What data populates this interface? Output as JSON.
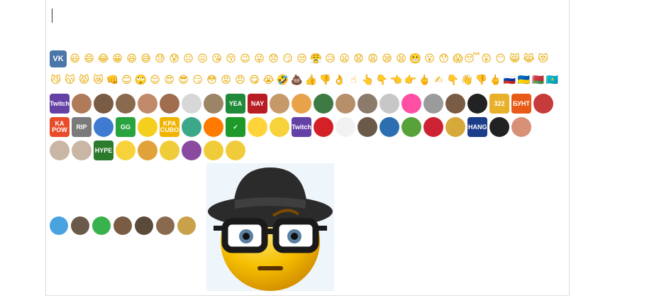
{
  "editor": {
    "cursor": "|"
  },
  "row1": {
    "vk_label": "VK",
    "emoji": [
      "😃",
      "😄",
      "😂",
      "😁",
      "😆",
      "😅",
      "😓",
      "😰",
      "😐",
      "😖",
      "😘",
      "😚",
      "😉",
      "😜",
      "😞",
      "😏",
      "😒",
      "😤",
      "😥",
      "😦",
      "😧",
      "😩",
      "😪",
      "😫",
      "😬",
      "😮",
      "😯",
      "😱",
      "😴",
      "😲",
      "😶",
      "😸",
      "😹",
      "😻"
    ]
  },
  "row2": {
    "emoji": [
      "😼",
      "😽",
      "😾",
      "😿",
      "👊",
      "😊",
      "🙄",
      "😌",
      "😍",
      "😎",
      "😏",
      "😳",
      "😡",
      "😠",
      "😋",
      "😭",
      "🤣",
      "💩",
      "👍",
      "👎",
      "👌",
      "☝",
      "👆",
      "👇",
      "👈",
      "👉",
      "🖕",
      "✍",
      "👇",
      "👋",
      "👎",
      "🖕",
      "🇷🇺",
      "🇺🇦",
      "🇧🇾",
      "🇰🇿"
    ]
  },
  "row3": {
    "items": [
      {
        "label": "Twitch",
        "color": "#6441a5"
      },
      {
        "label": "",
        "color": "#b07b5a"
      },
      {
        "label": "",
        "color": "#7a5c44"
      },
      {
        "label": "",
        "color": "#8a6a4f"
      },
      {
        "label": "",
        "color": "#c08a6a"
      },
      {
        "label": "",
        "color": "#a06d4f"
      },
      {
        "label": "",
        "color": "#d7d7d7"
      },
      {
        "label": "",
        "color": "#9c8467"
      },
      {
        "label": "YEA",
        "color": "#1f8a3a"
      },
      {
        "label": "NAY",
        "color": "#b81d23"
      },
      {
        "label": "",
        "color": "#c59a68"
      },
      {
        "label": "",
        "color": "#e7a24a"
      },
      {
        "label": "",
        "color": "#3d7a44"
      },
      {
        "label": "",
        "color": "#b68f6a"
      },
      {
        "label": "",
        "color": "#8c7a6a"
      },
      {
        "label": "",
        "color": "#c7c7c7"
      },
      {
        "label": "",
        "color": "#ff4fa5"
      },
      {
        "label": "",
        "color": "#9b9b9b"
      },
      {
        "label": "",
        "color": "#7a5c44"
      },
      {
        "label": "",
        "color": "#222222"
      },
      {
        "label": "322",
        "color": "#e9b12a"
      },
      {
        "label": "БУНТ",
        "color": "#e85a17"
      },
      {
        "label": "",
        "color": "#c83b3b"
      }
    ]
  },
  "row4": {
    "items": [
      {
        "label": "KA POW",
        "color": "#e94b2b"
      },
      {
        "label": "RIP",
        "color": "#7a7a7a"
      },
      {
        "label": "",
        "color": "#3f7bd0"
      },
      {
        "label": "GG",
        "color": "#28a33f"
      },
      {
        "label": "",
        "color": "#f4cf1d"
      },
      {
        "label": "KPA CUBO",
        "color": "#f0b400"
      },
      {
        "label": "",
        "color": "#3aa889"
      },
      {
        "label": "",
        "color": "#ff7a00"
      },
      {
        "label": "✓",
        "color": "#1f9a2a"
      },
      {
        "label": "",
        "color": "#ffd43b"
      },
      {
        "label": "",
        "color": "#f8d23b"
      },
      {
        "label": "Twitch",
        "color": "#6441a5"
      },
      {
        "label": "",
        "color": "#d42027"
      },
      {
        "label": "",
        "color": "#f2f2f2"
      },
      {
        "label": "",
        "color": "#6b5a4a"
      },
      {
        "label": "",
        "color": "#2b6fb0"
      },
      {
        "label": "",
        "color": "#58a23a"
      },
      {
        "label": "",
        "color": "#cc2233"
      },
      {
        "label": "",
        "color": "#d7a83a"
      },
      {
        "label": "CHANGE",
        "color": "#1b3d8a"
      },
      {
        "label": "",
        "color": "#222222"
      },
      {
        "label": "",
        "color": "#d89077"
      }
    ]
  },
  "row5": {
    "items": [
      {
        "label": "",
        "color": "#c9b6a5"
      },
      {
        "label": "",
        "color": "#c9b6a5"
      },
      {
        "label": "HYPE",
        "color": "#2c7a2c"
      },
      {
        "label": "",
        "color": "#f7d23a"
      },
      {
        "label": "",
        "color": "#e2a23a"
      },
      {
        "label": "",
        "color": "#f1cc3a"
      },
      {
        "label": "",
        "color": "#8a4aa0"
      },
      {
        "label": "",
        "color": "#f1cc3a"
      },
      {
        "label": "",
        "color": "#f1cc3a"
      }
    ]
  },
  "row6": {
    "items": [
      {
        "label": "",
        "color": "#4aa3e0"
      },
      {
        "label": "",
        "color": "#6b5a4a"
      },
      {
        "label": "",
        "color": "#37b24d"
      },
      {
        "label": "",
        "color": "#7a5c44"
      },
      {
        "label": "",
        "color": "#5a4a3a"
      },
      {
        "label": "",
        "color": "#8a6a4f"
      },
      {
        "label": "",
        "color": "#c9a14a"
      }
    ]
  },
  "big_emoji": {
    "colors": {
      "face": "#f5b800",
      "hat": "#2b2b2b",
      "glasses": "#1a1a1a"
    }
  }
}
